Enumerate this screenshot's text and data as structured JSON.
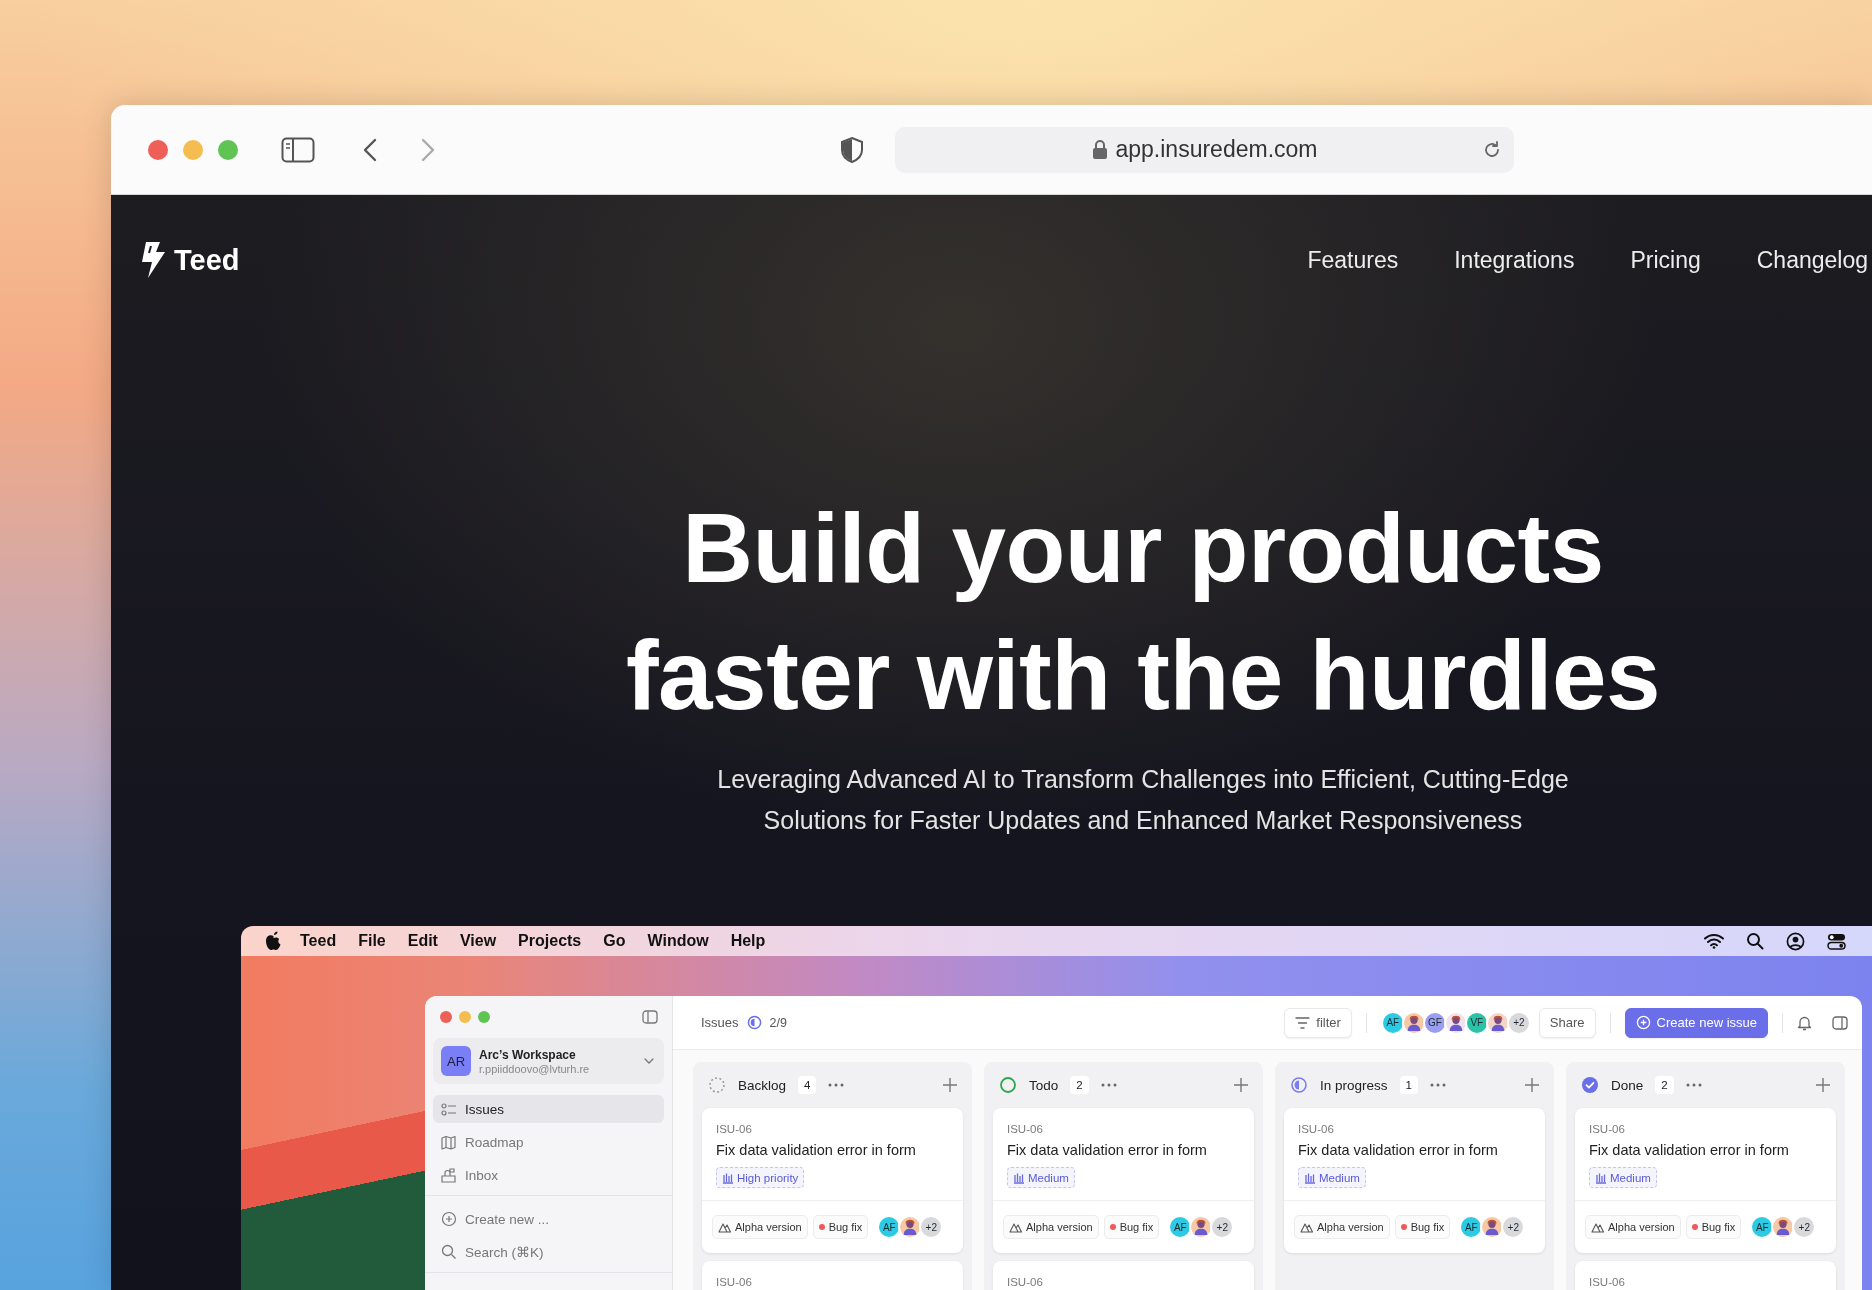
{
  "browser": {
    "url": "app.insuredem.com"
  },
  "site": {
    "brand": "Teed",
    "nav": [
      {
        "label": "Features"
      },
      {
        "label": "Integrations"
      },
      {
        "label": "Pricing"
      },
      {
        "label": "Changelog"
      }
    ]
  },
  "hero": {
    "title": "Build your products faster with the hurdles",
    "subtitle": "Leveraging Advanced AI to Transform Challenges into Efficient, Cutting-Edge Solutions for Faster Updates and Enhanced Market Responsiveness"
  },
  "menubar": {
    "app": "Teed",
    "items": [
      "File",
      "Edit",
      "View",
      "Projects",
      "Go",
      "Window",
      "Help"
    ]
  },
  "app": {
    "workspace": {
      "initials": "AR",
      "name": "Arc’s Workspace",
      "email": "r.ppiiddoovo@lvturh.re"
    },
    "nav": [
      {
        "label": "Issues",
        "kind": "list",
        "selected": true
      },
      {
        "label": "Roadmap",
        "kind": "map",
        "selected": false
      },
      {
        "label": "Inbox",
        "kind": "mailbox",
        "selected": false
      }
    ],
    "actions": [
      {
        "label": "Create new ...",
        "kind": "create"
      },
      {
        "label": "Search (⌘K)",
        "kind": "search"
      }
    ],
    "toolbar": {
      "title": "Issues",
      "progress": "2/9",
      "filter": "filter",
      "members": [
        {
          "kind": "initials",
          "text": "AF",
          "color": "#2ccbe3"
        },
        {
          "kind": "illustration",
          "color": "#f7c8a4"
        },
        {
          "kind": "initials",
          "text": "GF",
          "color": "#9b9ef0"
        },
        {
          "kind": "illustration",
          "color": "#f1e3ee"
        },
        {
          "kind": "initials",
          "text": "VF",
          "color": "#2bc3a6"
        },
        {
          "kind": "illustration",
          "color": "#f3d4c6"
        },
        {
          "kind": "count",
          "text": "+2",
          "color": "#d9d9dc"
        }
      ],
      "share": "Share",
      "create": "Create new issue"
    },
    "columns": [
      {
        "name": "Backlog",
        "kind": "backlog",
        "count": "4",
        "cards": [
          {
            "id": "ISU-06",
            "title": "Fix data validation error in form",
            "priority": "High priority",
            "milestone": "Alpha version",
            "label": "Bug fix",
            "assignees": [
              {
                "kind": "initials",
                "text": "AF",
                "color": "#2ccbe3"
              },
              {
                "kind": "illustration",
                "color": "#f7c8a4"
              },
              {
                "kind": "count",
                "text": "+2",
                "color": "#d9d9dc"
              }
            ]
          },
          {
            "id": "ISU-06"
          }
        ]
      },
      {
        "name": "Todo",
        "kind": "todo",
        "count": "2",
        "cards": [
          {
            "id": "ISU-06",
            "title": "Fix data validation error in form",
            "priority": "Medium",
            "milestone": "Alpha version",
            "label": "Bug fix",
            "assignees": [
              {
                "kind": "initials",
                "text": "AF",
                "color": "#2ccbe3"
              },
              {
                "kind": "illustration",
                "color": "#f7c8a4"
              },
              {
                "kind": "count",
                "text": "+2",
                "color": "#d9d9dc"
              }
            ]
          },
          {
            "id": "ISU-06"
          }
        ]
      },
      {
        "name": "In progress",
        "kind": "in_progress",
        "count": "1",
        "cards": [
          {
            "id": "ISU-06",
            "title": "Fix data validation error in form",
            "priority": "Medium",
            "milestone": "Alpha version",
            "label": "Bug fix",
            "assignees": [
              {
                "kind": "initials",
                "text": "AF",
                "color": "#2ccbe3"
              },
              {
                "kind": "illustration",
                "color": "#f7c8a4"
              },
              {
                "kind": "count",
                "text": "+2",
                "color": "#d9d9dc"
              }
            ]
          }
        ]
      },
      {
        "name": "Done",
        "kind": "done",
        "count": "2",
        "cards": [
          {
            "id": "ISU-06",
            "title": "Fix data validation error in form",
            "priority": "Medium",
            "milestone": "Alpha version",
            "label": "Bug fix",
            "assignees": [
              {
                "kind": "initials",
                "text": "AF",
                "color": "#2ccbe3"
              },
              {
                "kind": "illustration",
                "color": "#f7c8a4"
              },
              {
                "kind": "count",
                "text": "+2",
                "color": "#d9d9dc"
              }
            ]
          },
          {
            "id": "ISU-06"
          }
        ]
      }
    ]
  }
}
